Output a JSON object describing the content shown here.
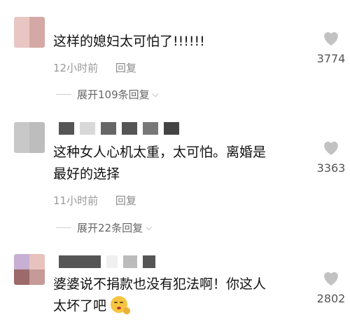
{
  "comments": [
    {
      "text": "这样的媳妇太可怕了!!!!!!",
      "time": "12小时前",
      "reply": "回复",
      "expand": "展开109条回复",
      "likes": "3774",
      "avatar_colors": [
        "#e9c6c4",
        "#d4a8a4",
        "#e9c6c4",
        "#d4a8a4"
      ]
    },
    {
      "text_line1": "这种女人心机太重，太可怕。离婚是",
      "text_line2": "最好的选择",
      "time": "11小时前",
      "reply": "回复",
      "expand": "展开22条回复",
      "likes": "3363",
      "avatar_colors": [
        "#c8c8c8",
        "#bdbdbd",
        "#c8c8c8",
        "#bdbdbd"
      ]
    },
    {
      "text_line1": "婆婆说不捐款也没有犯法啊！你这人",
      "text_line2": "太坏了吧",
      "likes": "2802",
      "emoji": "face-with-hand-over-mouth",
      "avatar_colors": [
        "#c7b0d4",
        "#e8c2bd",
        "#9c6a6a",
        "#c59a97"
      ]
    }
  ],
  "colors": {
    "heart": "#c2c2c2",
    "muted_text": "#9a9a9a"
  }
}
